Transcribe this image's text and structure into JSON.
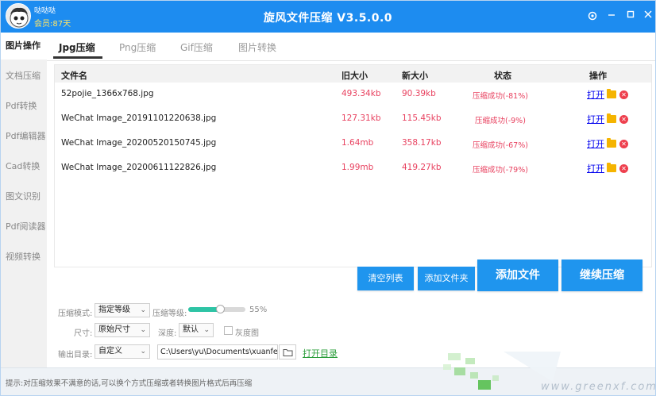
{
  "titlebar": {
    "username": "哒哒哒",
    "membership": "会员:87天",
    "title": "旋风文件压缩 V3.5.0.0"
  },
  "sidebar": {
    "items": [
      {
        "label": "图片操作",
        "active": true
      },
      {
        "label": "文档压缩"
      },
      {
        "label": "Pdf转换"
      },
      {
        "label": "Pdf编辑器"
      },
      {
        "label": "Cad转换"
      },
      {
        "label": "图文识别"
      },
      {
        "label": "Pdf阅读器"
      },
      {
        "label": "视频转换"
      }
    ]
  },
  "tabs": [
    {
      "label": "Jpg压缩",
      "active": true
    },
    {
      "label": "Png压缩"
    },
    {
      "label": "Gif压缩"
    },
    {
      "label": "图片转换"
    }
  ],
  "table": {
    "headers": {
      "name": "文件名",
      "old": "旧大小",
      "new": "新大小",
      "status": "状态",
      "ops": "操作"
    },
    "rows": [
      {
        "name": "52pojie_1366x768.jpg",
        "old": "493.34kb",
        "new": "90.39kb",
        "status": "压缩成功(-81%)",
        "open": "打开"
      },
      {
        "name": "WeChat Image_20191101220638.jpg",
        "old": "127.31kb",
        "new": "115.45kb",
        "status": "压缩成功(-9%)",
        "open": "打开"
      },
      {
        "name": "WeChat Image_20200520150745.jpg",
        "old": "1.64mb",
        "new": "358.17kb",
        "status": "压缩成功(-67%)",
        "open": "打开"
      },
      {
        "name": "WeChat Image_20200611122826.jpg",
        "old": "1.99mb",
        "new": "419.27kb",
        "status": "压缩成功(-79%)",
        "open": "打开"
      }
    ]
  },
  "buttons": {
    "clear": "清空列表",
    "add_folder": "添加文件夹",
    "add_file": "添加文件",
    "continue": "继续压缩"
  },
  "options": {
    "mode_label": "压缩模式:",
    "mode_value": "指定等级",
    "level_label": "压缩等级:",
    "level_value": "55%",
    "level_fraction": 0.55,
    "size_label": "尺寸:",
    "size_value": "原始尺寸",
    "depth_label": "深度:",
    "depth_value": "默认",
    "grayscale_label": "灰度图",
    "output_label": "输出目录:",
    "output_value": "自定义",
    "output_path": "C:\\Users\\yu\\Documents\\xuanfe",
    "open_dir": "打开目录"
  },
  "statusbar": {
    "text": "提示:对压缩效果不满意的话,可以换个方式压缩或者转换图片格式后再压缩"
  },
  "watermark": "www.greenxf.com",
  "colors": {
    "titlebar": "#1d8cf0",
    "accent_button": "#1f95ee",
    "size_red": "#e8415f",
    "slider": "#2ec4a5",
    "open_link": "#0000ee",
    "open_dir": "#2a9d3a"
  }
}
